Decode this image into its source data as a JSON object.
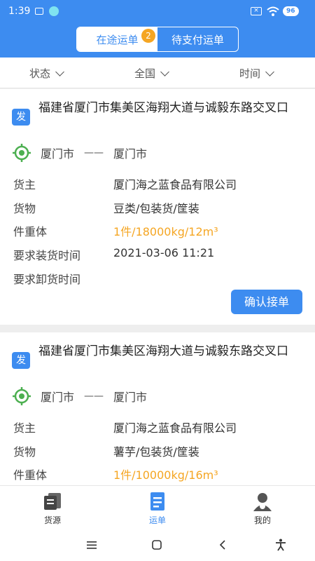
{
  "status_bar": {
    "time": "1:39",
    "battery": "96"
  },
  "header": {
    "tabs": [
      {
        "label": "在途运单",
        "badge": "2"
      },
      {
        "label": "待支付运单"
      }
    ]
  },
  "filters": [
    "状态",
    "全国",
    "时间"
  ],
  "orders": [
    {
      "tag": "发",
      "address": "福建省厦门市集美区海翔大道与诚毅东路交叉口",
      "from": "厦门市",
      "arrow": "——",
      "to": "厦门市",
      "shipper_label": "货主",
      "shipper": "厦门海之蓝食品有限公司",
      "goods_label": "货物",
      "goods": "豆类/包装货/筐装",
      "weight_label": "件重体",
      "weight": "1件/18000kg/12m³",
      "load_label": "要求装货时间",
      "load_time": "2021-03-06 11:21",
      "unload_label": "要求卸货时间",
      "button": "确认接单"
    },
    {
      "tag": "发",
      "address": "福建省厦门市集美区海翔大道与诚毅东路交叉口",
      "from": "厦门市",
      "arrow": "——",
      "to": "厦门市",
      "shipper_label": "货主",
      "shipper": "厦门海之蓝食品有限公司",
      "goods_label": "货物",
      "goods": "薯芋/包装货/筐装",
      "weight_label": "件重体",
      "weight": "1件/10000kg/16m³"
    }
  ],
  "tabbar": [
    "货源",
    "运单",
    "我的"
  ],
  "colors": {
    "primary": "#3d8cf0",
    "accent": "#f5a623",
    "location": "#4caf50"
  }
}
